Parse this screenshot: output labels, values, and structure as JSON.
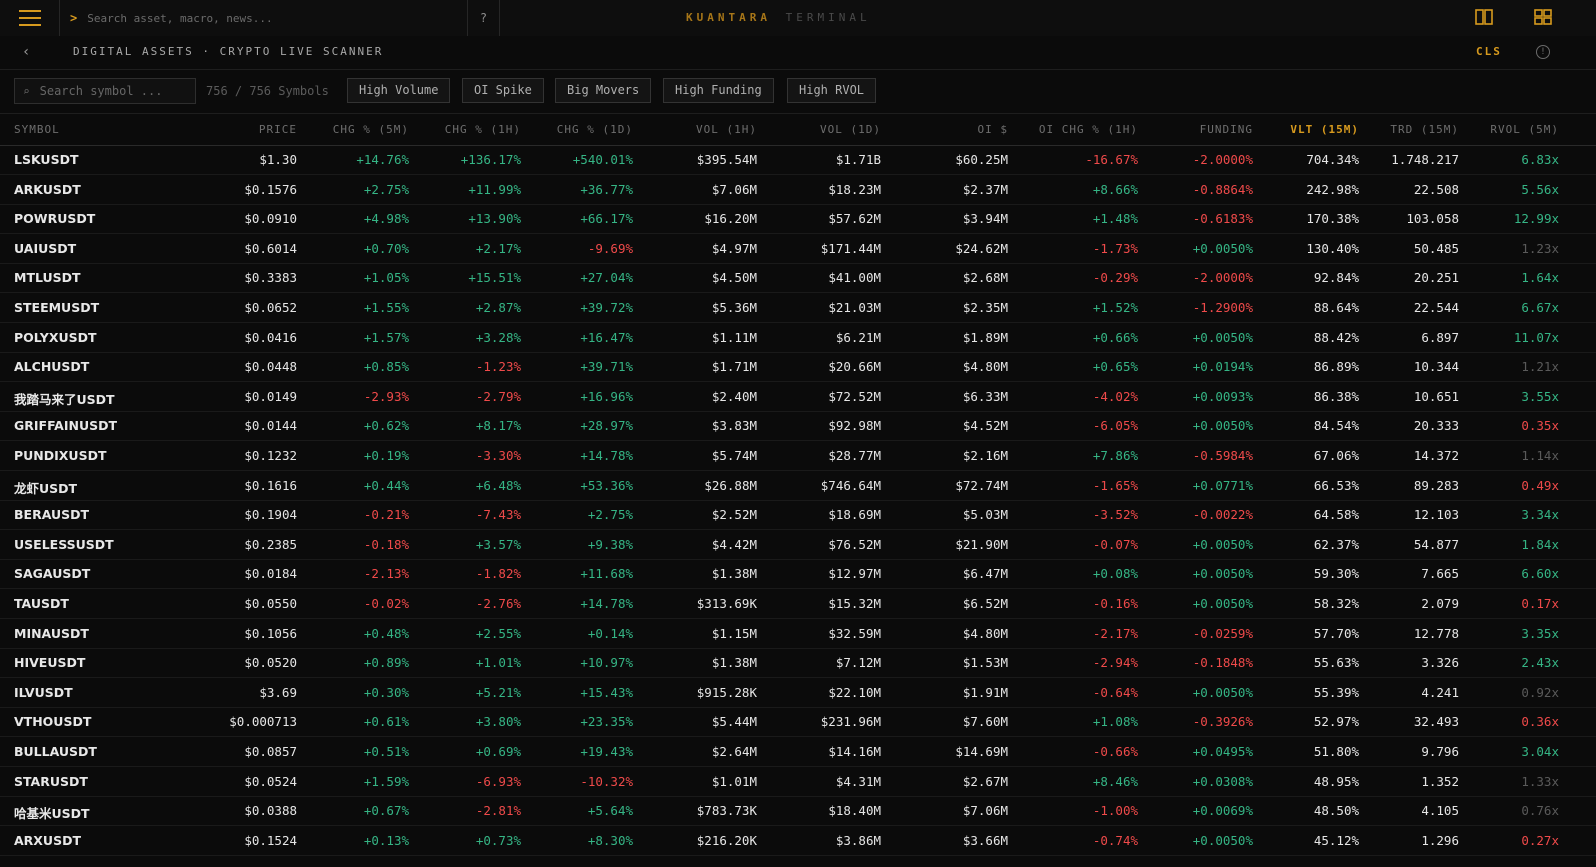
{
  "topbar": {
    "prompt_symbol": ">",
    "search_placeholder": "Search asset, macro, news...",
    "help_label": "?",
    "brand_primary": "KUANTARA",
    "brand_secondary": "TERMINAL"
  },
  "subheader": {
    "back_icon": "‹",
    "breadcrumb": "DIGITAL ASSETS · CRYPTO LIVE SCANNER",
    "cls_label": "CLS",
    "info_icon": "!"
  },
  "filters": {
    "search_placeholder": "Search symbol ...",
    "symbol_count": "756 / 756 Symbols",
    "chips": [
      "High Volume",
      "OI Spike",
      "Big Movers",
      "High Funding",
      "High RVOL"
    ]
  },
  "colors": {
    "accent": "#d79a1e",
    "positive": "#35b585",
    "negative": "#ef4a4a",
    "background": "#0b0b0b"
  },
  "table": {
    "columns": [
      "SYMBOL",
      "PRICE",
      "CHG % (5M)",
      "CHG % (1H)",
      "CHG % (1D)",
      "VOL (1H)",
      "VOL (1D)",
      "OI $",
      "OI CHG % (1H)",
      "FUNDING",
      "VLT (15M)",
      "TRD (15M)",
      "RVOL (5M)"
    ],
    "sorted_column": "VLT (15M)",
    "rows": [
      [
        "LSKUSDT",
        "$1.30",
        "+14.76%",
        "+136.17%",
        "+540.01%",
        "$395.54M",
        "$1.71B",
        "$60.25M",
        "-16.67%",
        "-2.0000%",
        "704.34%",
        "1.748.217",
        "6.83x"
      ],
      [
        "ARKUSDT",
        "$0.1576",
        "+2.75%",
        "+11.99%",
        "+36.77%",
        "$7.06M",
        "$18.23M",
        "$2.37M",
        "+8.66%",
        "-0.8864%",
        "242.98%",
        "22.508",
        "5.56x"
      ],
      [
        "POWRUSDT",
        "$0.0910",
        "+4.98%",
        "+13.90%",
        "+66.17%",
        "$16.20M",
        "$57.62M",
        "$3.94M",
        "+1.48%",
        "-0.6183%",
        "170.38%",
        "103.058",
        "12.99x"
      ],
      [
        "UAIUSDT",
        "$0.6014",
        "+0.70%",
        "+2.17%",
        "-9.69%",
        "$4.97M",
        "$171.44M",
        "$24.62M",
        "-1.73%",
        "+0.0050%",
        "130.40%",
        "50.485",
        "1.23x"
      ],
      [
        "MTLUSDT",
        "$0.3383",
        "+1.05%",
        "+15.51%",
        "+27.04%",
        "$4.50M",
        "$41.00M",
        "$2.68M",
        "-0.29%",
        "-2.0000%",
        "92.84%",
        "20.251",
        "1.64x"
      ],
      [
        "STEEMUSDT",
        "$0.0652",
        "+1.55%",
        "+2.87%",
        "+39.72%",
        "$5.36M",
        "$21.03M",
        "$2.35M",
        "+1.52%",
        "-1.2900%",
        "88.64%",
        "22.544",
        "6.67x"
      ],
      [
        "POLYXUSDT",
        "$0.0416",
        "+1.57%",
        "+3.28%",
        "+16.47%",
        "$1.11M",
        "$6.21M",
        "$1.89M",
        "+0.66%",
        "+0.0050%",
        "88.42%",
        "6.897",
        "11.07x"
      ],
      [
        "ALCHUSDT",
        "$0.0448",
        "+0.85%",
        "-1.23%",
        "+39.71%",
        "$1.71M",
        "$20.66M",
        "$4.80M",
        "+0.65%",
        "+0.0194%",
        "86.89%",
        "10.344",
        "1.21x"
      ],
      [
        "我踏马来了USDT",
        "$0.0149",
        "-2.93%",
        "-2.79%",
        "+16.96%",
        "$2.40M",
        "$72.52M",
        "$6.33M",
        "-4.02%",
        "+0.0093%",
        "86.38%",
        "10.651",
        "3.55x"
      ],
      [
        "GRIFFAINUSDT",
        "$0.0144",
        "+0.62%",
        "+8.17%",
        "+28.97%",
        "$3.83M",
        "$92.98M",
        "$4.52M",
        "-6.05%",
        "+0.0050%",
        "84.54%",
        "20.333",
        "0.35x"
      ],
      [
        "PUNDIXUSDT",
        "$0.1232",
        "+0.19%",
        "-3.30%",
        "+14.78%",
        "$5.74M",
        "$28.77M",
        "$2.16M",
        "+7.86%",
        "-0.5984%",
        "67.06%",
        "14.372",
        "1.14x"
      ],
      [
        "龙虾USDT",
        "$0.1616",
        "+0.44%",
        "+6.48%",
        "+53.36%",
        "$26.88M",
        "$746.64M",
        "$72.74M",
        "-1.65%",
        "+0.0771%",
        "66.53%",
        "89.283",
        "0.49x"
      ],
      [
        "BERAUSDT",
        "$0.1904",
        "-0.21%",
        "-7.43%",
        "+2.75%",
        "$2.52M",
        "$18.69M",
        "$5.03M",
        "-3.52%",
        "-0.0022%",
        "64.58%",
        "12.103",
        "3.34x"
      ],
      [
        "USELESSUSDT",
        "$0.2385",
        "-0.18%",
        "+3.57%",
        "+9.38%",
        "$4.42M",
        "$76.52M",
        "$21.90M",
        "-0.07%",
        "+0.0050%",
        "62.37%",
        "54.877",
        "1.84x"
      ],
      [
        "SAGAUSDT",
        "$0.0184",
        "-2.13%",
        "-1.82%",
        "+11.68%",
        "$1.38M",
        "$12.97M",
        "$6.47M",
        "+0.08%",
        "+0.0050%",
        "59.30%",
        "7.665",
        "6.60x"
      ],
      [
        "TAUSDT",
        "$0.0550",
        "-0.02%",
        "-2.76%",
        "+14.78%",
        "$313.69K",
        "$15.32M",
        "$6.52M",
        "-0.16%",
        "+0.0050%",
        "58.32%",
        "2.079",
        "0.17x"
      ],
      [
        "MINAUSDT",
        "$0.1056",
        "+0.48%",
        "+2.55%",
        "+0.14%",
        "$1.15M",
        "$32.59M",
        "$4.80M",
        "-2.17%",
        "-0.0259%",
        "57.70%",
        "12.778",
        "3.35x"
      ],
      [
        "HIVEUSDT",
        "$0.0520",
        "+0.89%",
        "+1.01%",
        "+10.97%",
        "$1.38M",
        "$7.12M",
        "$1.53M",
        "-2.94%",
        "-0.1848%",
        "55.63%",
        "3.326",
        "2.43x"
      ],
      [
        "ILVUSDT",
        "$3.69",
        "+0.30%",
        "+5.21%",
        "+15.43%",
        "$915.28K",
        "$22.10M",
        "$1.91M",
        "-0.64%",
        "+0.0050%",
        "55.39%",
        "4.241",
        "0.92x"
      ],
      [
        "VTHOUSDT",
        "$0.000713",
        "+0.61%",
        "+3.80%",
        "+23.35%",
        "$5.44M",
        "$231.96M",
        "$7.60M",
        "+1.08%",
        "-0.3926%",
        "52.97%",
        "32.493",
        "0.36x"
      ],
      [
        "BULLAUSDT",
        "$0.0857",
        "+0.51%",
        "+0.69%",
        "+19.43%",
        "$2.64M",
        "$14.16M",
        "$14.69M",
        "-0.66%",
        "+0.0495%",
        "51.80%",
        "9.796",
        "3.04x"
      ],
      [
        "STARUSDT",
        "$0.0524",
        "+1.59%",
        "-6.93%",
        "-10.32%",
        "$1.01M",
        "$4.31M",
        "$2.67M",
        "+8.46%",
        "+0.0308%",
        "48.95%",
        "1.352",
        "1.33x"
      ],
      [
        "哈基米USDT",
        "$0.0388",
        "+0.67%",
        "-2.81%",
        "+5.64%",
        "$783.73K",
        "$18.40M",
        "$7.06M",
        "-1.00%",
        "+0.0069%",
        "48.50%",
        "4.105",
        "0.76x"
      ],
      [
        "ARXUSDT",
        "$0.1524",
        "+0.13%",
        "+0.73%",
        "+8.30%",
        "$216.20K",
        "$3.86M",
        "$3.66M",
        "-0.74%",
        "+0.0050%",
        "45.12%",
        "1.296",
        "0.27x"
      ]
    ]
  }
}
